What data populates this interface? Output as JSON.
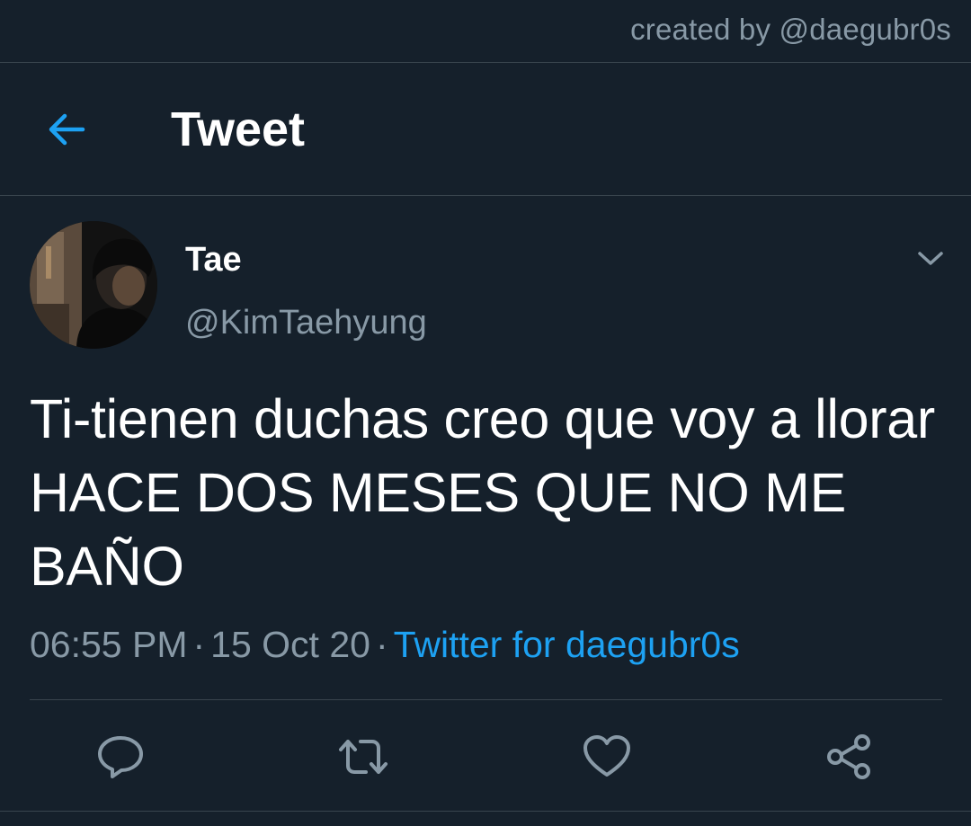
{
  "watermark": {
    "text": "created by @daegubr0s"
  },
  "header": {
    "title": "Tweet",
    "back_icon": "arrow-left-icon"
  },
  "tweet": {
    "author": {
      "name": "Tae",
      "handle": "@KimTaehyung"
    },
    "text": "Ti-tienen duchas creo que voy a llorar HACE DOS MESES QUE NO ME BAÑO",
    "time": "06:55 PM",
    "date": "15 Oct 20",
    "source": "Twitter for daegubr0s",
    "separator": "·"
  },
  "actions": [
    {
      "name": "reply",
      "icon": "comment-icon"
    },
    {
      "name": "retweet",
      "icon": "retweet-icon"
    },
    {
      "name": "like",
      "icon": "heart-icon"
    },
    {
      "name": "share",
      "icon": "share-icon"
    }
  ],
  "colors": {
    "background": "#15202b",
    "accent": "#1da1f2",
    "secondary_text": "#8899a6",
    "divider": "#38444d"
  }
}
